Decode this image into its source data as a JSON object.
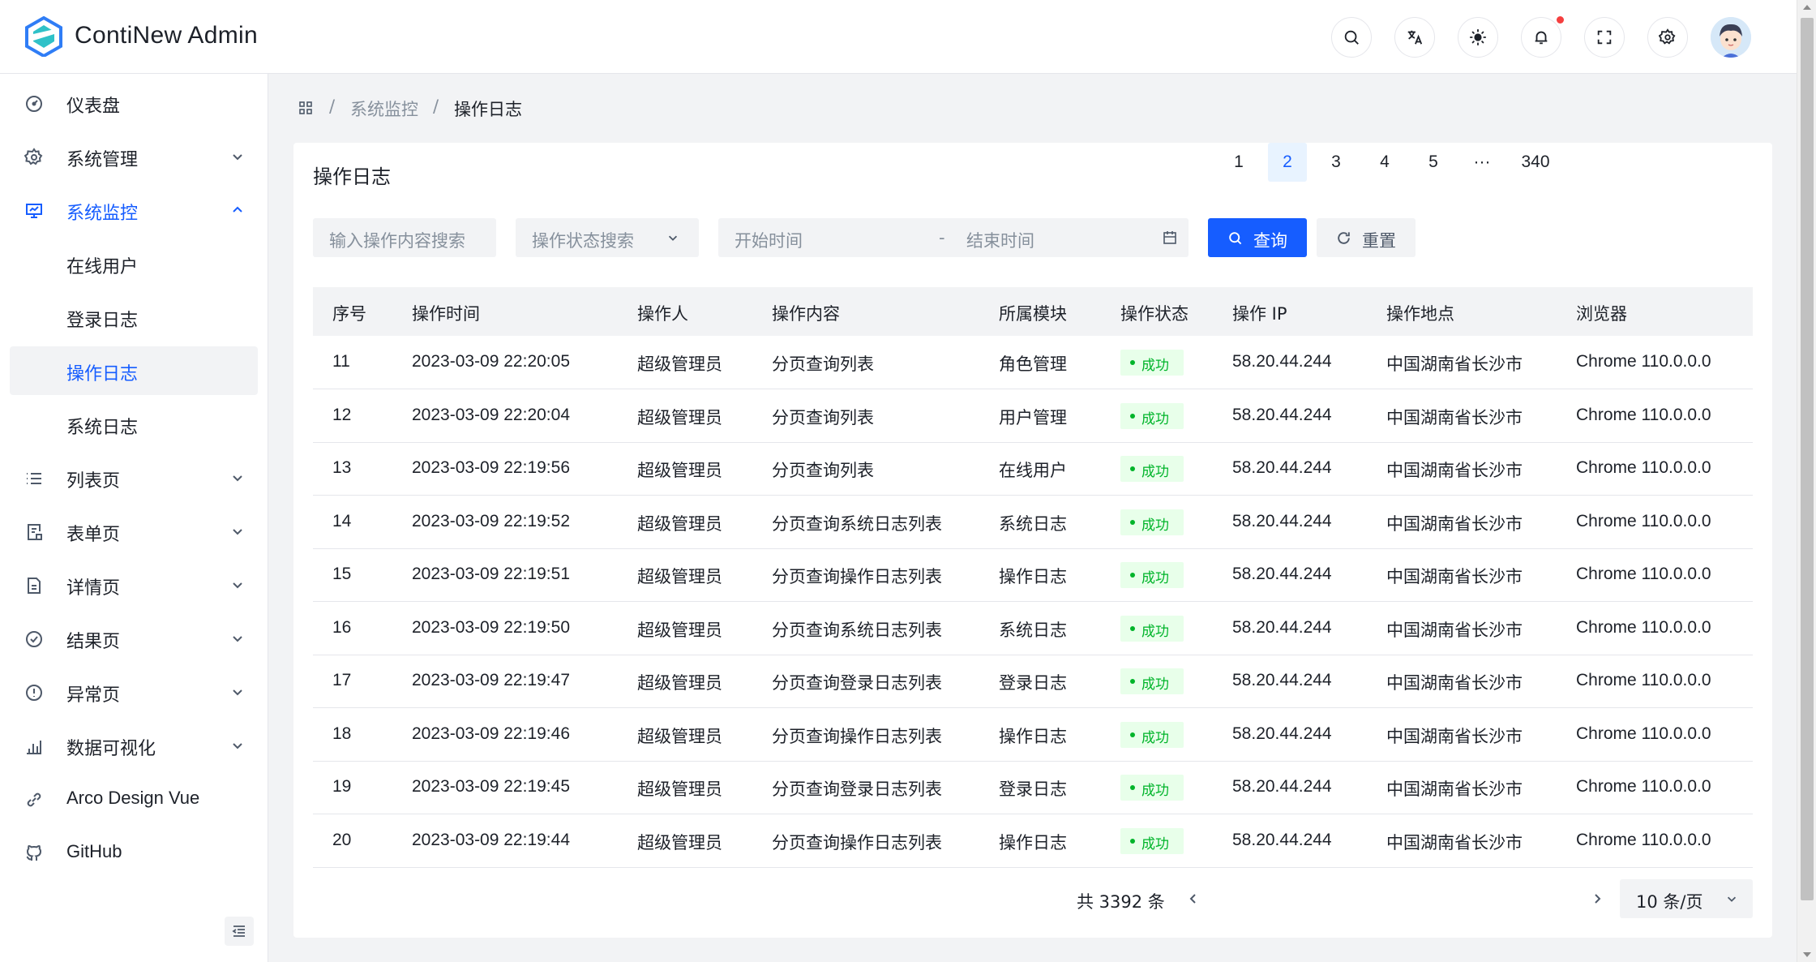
{
  "header": {
    "brand": "ContiNew Admin",
    "actions": [
      "search-icon",
      "translate-icon",
      "theme-icon",
      "bell-icon",
      "fullscreen-icon",
      "settings-icon"
    ]
  },
  "sidebar": {
    "items": [
      {
        "label": "仪表盘",
        "icon": "dashboard-icon"
      },
      {
        "label": "系统管理",
        "icon": "gear-icon"
      },
      {
        "label": "系统监控",
        "icon": "monitor-icon"
      },
      {
        "label": "在线用户"
      },
      {
        "label": "登录日志"
      },
      {
        "label": "操作日志"
      },
      {
        "label": "系统日志"
      },
      {
        "label": "列表页",
        "icon": "list-icon"
      },
      {
        "label": "表单页",
        "icon": "form-icon"
      },
      {
        "label": "详情页",
        "icon": "file-icon"
      },
      {
        "label": "结果页",
        "icon": "check-circle-icon"
      },
      {
        "label": "异常页",
        "icon": "exclamation-circle-icon"
      },
      {
        "label": "数据可视化",
        "icon": "bar-chart-icon"
      },
      {
        "label": "Arco Design Vue",
        "icon": "link-icon"
      },
      {
        "label": "GitHub",
        "icon": "github-icon"
      }
    ]
  },
  "breadcrumb": {
    "separator": "/",
    "items": [
      "系统监控",
      "操作日志"
    ]
  },
  "card": {
    "title": "操作日志"
  },
  "filters": {
    "content_placeholder": "输入操作内容搜索",
    "status_placeholder": "操作状态搜索",
    "start_placeholder": "开始时间",
    "range_sep": "-",
    "end_placeholder": "结束时间",
    "query_label": "查询",
    "reset_label": "重置"
  },
  "table": {
    "columns": [
      "序号",
      "操作时间",
      "操作人",
      "操作内容",
      "所属模块",
      "操作状态",
      "操作 IP",
      "操作地点",
      "浏览器"
    ],
    "rows": [
      [
        "11",
        "2023-03-09 22:20:05",
        "超级管理员",
        "分页查询列表",
        "角色管理",
        "成功",
        "58.20.44.244",
        "中国湖南省长沙市",
        "Chrome 110.0.0.0"
      ],
      [
        "12",
        "2023-03-09 22:20:04",
        "超级管理员",
        "分页查询列表",
        "用户管理",
        "成功",
        "58.20.44.244",
        "中国湖南省长沙市",
        "Chrome 110.0.0.0"
      ],
      [
        "13",
        "2023-03-09 22:19:56",
        "超级管理员",
        "分页查询列表",
        "在线用户",
        "成功",
        "58.20.44.244",
        "中国湖南省长沙市",
        "Chrome 110.0.0.0"
      ],
      [
        "14",
        "2023-03-09 22:19:52",
        "超级管理员",
        "分页查询系统日志列表",
        "系统日志",
        "成功",
        "58.20.44.244",
        "中国湖南省长沙市",
        "Chrome 110.0.0.0"
      ],
      [
        "15",
        "2023-03-09 22:19:51",
        "超级管理员",
        "分页查询操作日志列表",
        "操作日志",
        "成功",
        "58.20.44.244",
        "中国湖南省长沙市",
        "Chrome 110.0.0.0"
      ],
      [
        "16",
        "2023-03-09 22:19:50",
        "超级管理员",
        "分页查询系统日志列表",
        "系统日志",
        "成功",
        "58.20.44.244",
        "中国湖南省长沙市",
        "Chrome 110.0.0.0"
      ],
      [
        "17",
        "2023-03-09 22:19:47",
        "超级管理员",
        "分页查询登录日志列表",
        "登录日志",
        "成功",
        "58.20.44.244",
        "中国湖南省长沙市",
        "Chrome 110.0.0.0"
      ],
      [
        "18",
        "2023-03-09 22:19:46",
        "超级管理员",
        "分页查询操作日志列表",
        "操作日志",
        "成功",
        "58.20.44.244",
        "中国湖南省长沙市",
        "Chrome 110.0.0.0"
      ],
      [
        "19",
        "2023-03-09 22:19:45",
        "超级管理员",
        "分页查询登录日志列表",
        "登录日志",
        "成功",
        "58.20.44.244",
        "中国湖南省长沙市",
        "Chrome 110.0.0.0"
      ],
      [
        "20",
        "2023-03-09 22:19:44",
        "超级管理员",
        "分页查询操作日志列表",
        "操作日志",
        "成功",
        "58.20.44.244",
        "中国湖南省长沙市",
        "Chrome 110.0.0.0"
      ]
    ]
  },
  "pagination": {
    "total_text": "共 3392 条",
    "pages": [
      "1",
      "2",
      "3",
      "4",
      "5",
      "···",
      "340"
    ],
    "current": "2",
    "page_size": "10 条/页"
  },
  "colors": {
    "primary": "#165dff",
    "success": "#00b42a",
    "success_bg": "#e8ffea",
    "danger": "#f53f3f"
  }
}
